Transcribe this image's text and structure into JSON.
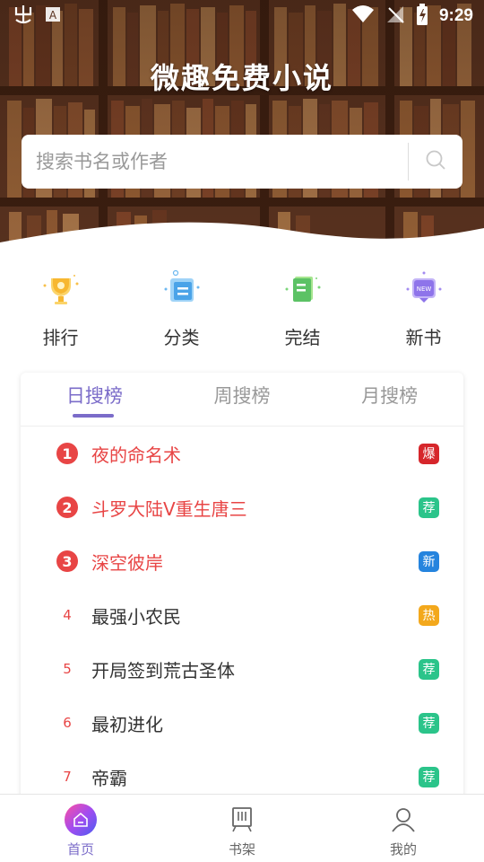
{
  "status_bar": {
    "time": "9:29",
    "left_icons": [
      "app-notification-icon",
      "a-box-icon"
    ],
    "right_icons": [
      "wifi-icon",
      "no-signal-icon",
      "battery-icon"
    ]
  },
  "app": {
    "title": "微趣免费小说"
  },
  "search": {
    "placeholder": "搜索书名或作者",
    "value": ""
  },
  "categories": [
    {
      "label": "排行",
      "icon": "trophy-icon"
    },
    {
      "label": "分类",
      "icon": "category-icon"
    },
    {
      "label": "完结",
      "icon": "completed-book-icon"
    },
    {
      "label": "新书",
      "icon": "new-book-icon"
    }
  ],
  "ranking": {
    "tabs": [
      "日搜榜",
      "周搜榜",
      "月搜榜"
    ],
    "active_tab": 0,
    "items": [
      {
        "rank": "1",
        "title": "夜的命名术",
        "badge": "爆",
        "badge_color": "#d6262b"
      },
      {
        "rank": "2",
        "title": "斗罗大陆V重生唐三",
        "badge": "荐",
        "badge_color": "#2bc48a"
      },
      {
        "rank": "3",
        "title": "深空彼岸",
        "badge": "新",
        "badge_color": "#2584de"
      },
      {
        "rank": "4",
        "title": "最强小农民",
        "badge": "热",
        "badge_color": "#f3a81c"
      },
      {
        "rank": "5",
        "title": "开局签到荒古圣体",
        "badge": "荐",
        "badge_color": "#2bc48a"
      },
      {
        "rank": "6",
        "title": "最初进化",
        "badge": "荐",
        "badge_color": "#2bc48a"
      },
      {
        "rank": "7",
        "title": "帝霸",
        "badge": "荐",
        "badge_color": "#2bc48a"
      }
    ]
  },
  "bottom_nav": {
    "items": [
      {
        "label": "首页",
        "icon": "home-icon",
        "active": true
      },
      {
        "label": "书架",
        "icon": "bookshelf-icon",
        "active": false
      },
      {
        "label": "我的",
        "icon": "profile-icon",
        "active": false
      }
    ]
  },
  "colors": {
    "accent": "#7b6cc9",
    "rank_red": "#e84545",
    "header_bg": "#4a2a1a"
  }
}
